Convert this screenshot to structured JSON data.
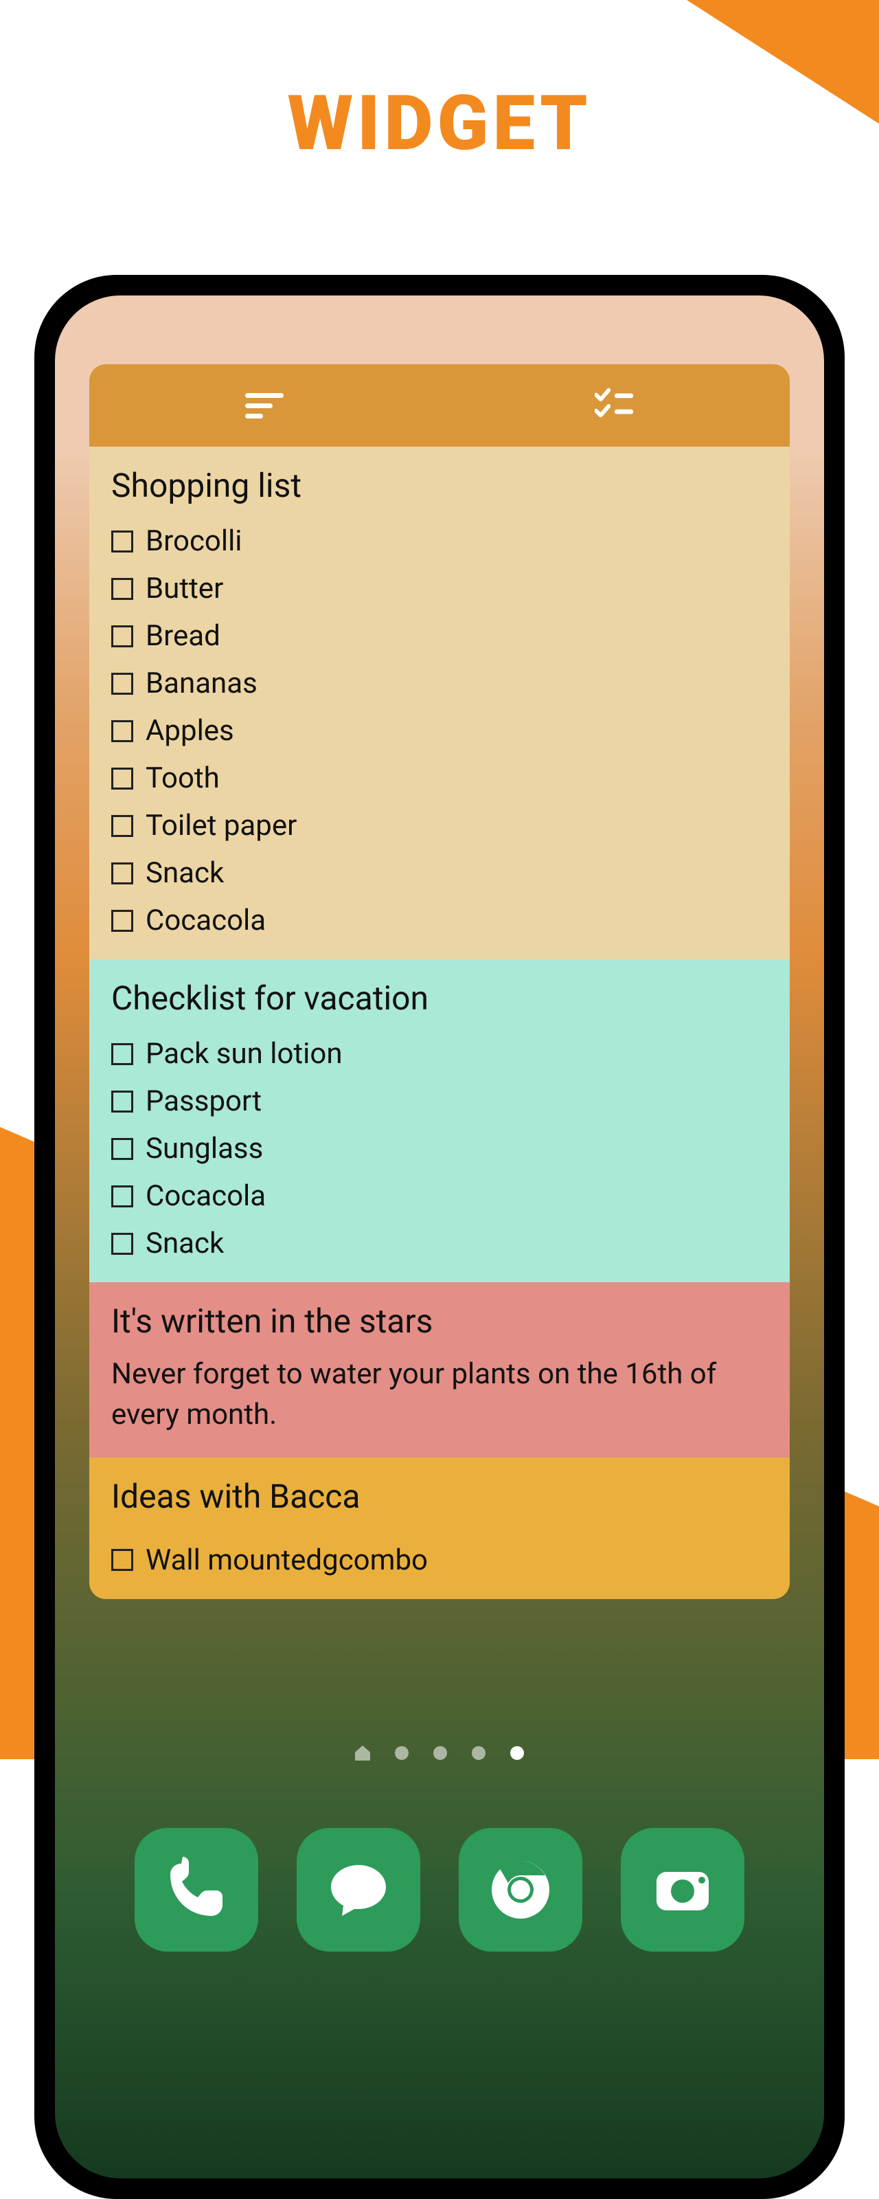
{
  "page": {
    "title": "WIDGET"
  },
  "widget": {
    "header": {
      "sort_icon_name": "sort-lines-icon",
      "checklist_icon_name": "checklist-icon"
    },
    "notes": {
      "shopping": {
        "title": "Shopping list",
        "items": [
          "Brocolli",
          "Butter",
          "Bread",
          "Bananas",
          "Apples",
          "Tooth",
          "Toilet paper",
          "Snack",
          "Cocacola"
        ]
      },
      "vacation": {
        "title": "Checklist for vacation",
        "items": [
          "Pack sun lotion",
          "Passport",
          "Sunglass",
          "Cocacola",
          "Snack"
        ]
      },
      "stars": {
        "title": "It's written in the stars",
        "body": "Never forget to water your plants on the 16th of every month."
      },
      "ideas": {
        "title": "Ideas with Bacca",
        "items": [
          "Wall mountedgcombo"
        ]
      }
    }
  },
  "home": {
    "page_count": 5,
    "active_page": 5,
    "dock": {
      "phone": "Phone",
      "messages": "Messages",
      "chrome": "Chrome",
      "camera": "Camera"
    }
  },
  "colors": {
    "accent": "#f38a1f",
    "widget_header": "#d99739",
    "dock_app": "#2d9b5a"
  }
}
